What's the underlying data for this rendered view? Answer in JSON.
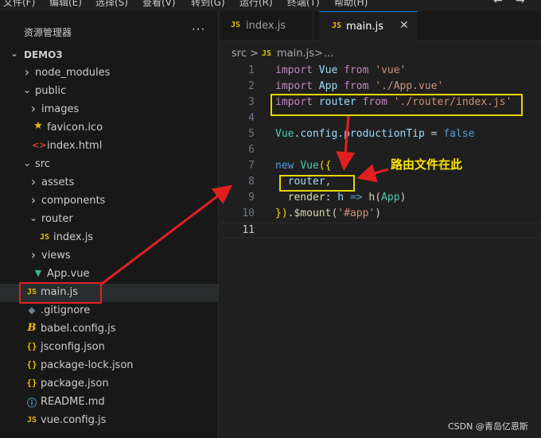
{
  "menubar": {
    "items": [
      "文件(F)",
      "编辑(E)",
      "选择(S)",
      "查看(V)",
      "转到(G)",
      "运行(R)",
      "终端(T)",
      "帮助(H)"
    ],
    "back_icon": "arrow-left-icon",
    "forward_icon": "arrow-right-icon"
  },
  "sidebar": {
    "title": "资源管理器",
    "more": "···",
    "root": "DEMO3",
    "tree": [
      {
        "label": "node_modules",
        "icon": "chevron-right-icon",
        "type": "folder"
      },
      {
        "label": "public",
        "icon": "chevron-down-icon",
        "type": "folder"
      },
      {
        "label": "images",
        "icon": "chevron-right-icon",
        "type": "folder"
      },
      {
        "label": "favicon.ico",
        "icon": "star-icon",
        "type": "file"
      },
      {
        "label": "index.html",
        "icon": "html-icon",
        "type": "file"
      },
      {
        "label": "src",
        "icon": "chevron-down-icon",
        "type": "folder"
      },
      {
        "label": "assets",
        "icon": "chevron-right-icon",
        "type": "folder"
      },
      {
        "label": "components",
        "icon": "chevron-right-icon",
        "type": "folder"
      },
      {
        "label": "router",
        "icon": "chevron-down-icon",
        "type": "folder"
      },
      {
        "label": "index.js",
        "icon": "js-icon",
        "type": "file"
      },
      {
        "label": "views",
        "icon": "chevron-right-icon",
        "type": "folder"
      },
      {
        "label": "App.vue",
        "icon": "vue-icon",
        "type": "file"
      },
      {
        "label": "main.js",
        "icon": "js-icon",
        "type": "file",
        "selected": true
      },
      {
        "label": ".gitignore",
        "icon": "git-icon",
        "type": "file"
      },
      {
        "label": "babel.config.js",
        "icon": "babel-icon",
        "type": "file"
      },
      {
        "label": "jsconfig.json",
        "icon": "json-icon",
        "type": "file"
      },
      {
        "label": "package-lock.json",
        "icon": "json-icon",
        "type": "file"
      },
      {
        "label": "package.json",
        "icon": "json-icon",
        "type": "file"
      },
      {
        "label": "README.md",
        "icon": "info-icon",
        "type": "file"
      },
      {
        "label": "vue.config.js",
        "icon": "js-icon",
        "type": "file"
      }
    ]
  },
  "tabs": [
    {
      "label": "index.js",
      "icon_text": "JS",
      "active": false
    },
    {
      "label": "main.js",
      "icon_text": "JS",
      "active": true,
      "close": "✕"
    }
  ],
  "breadcrumb": {
    "folder": "src",
    "sep": ">",
    "icon_text": "JS",
    "file": "main.js",
    "sep2": ">",
    "more": "..."
  },
  "icon_texts": {
    "js": "JS",
    "json": "{}",
    "html": "<>",
    "git": "◆",
    "babel": "B",
    "info": "ⓘ",
    "star": "★",
    "vue": "▼"
  },
  "code": {
    "lines": [
      {
        "n": "1",
        "tokens": [
          [
            "kw",
            "import"
          ],
          [
            "plain",
            " "
          ],
          [
            "var",
            "Vue"
          ],
          [
            "plain",
            " "
          ],
          [
            "kw",
            "from"
          ],
          [
            "plain",
            " "
          ],
          [
            "str",
            "'vue'"
          ]
        ]
      },
      {
        "n": "2",
        "tokens": [
          [
            "kw",
            "import"
          ],
          [
            "plain",
            " "
          ],
          [
            "var",
            "App"
          ],
          [
            "plain",
            " "
          ],
          [
            "kw",
            "from"
          ],
          [
            "plain",
            " "
          ],
          [
            "str",
            "'./App.vue'"
          ]
        ]
      },
      {
        "n": "3",
        "tokens": [
          [
            "kw",
            "import"
          ],
          [
            "plain",
            " "
          ],
          [
            "var",
            "router"
          ],
          [
            "plain",
            " "
          ],
          [
            "kw",
            "from"
          ],
          [
            "plain",
            " "
          ],
          [
            "str",
            "'./router/index.js'"
          ]
        ]
      },
      {
        "n": "4",
        "tokens": []
      },
      {
        "n": "5",
        "tokens": [
          [
            "cls",
            "Vue"
          ],
          [
            "plain",
            "."
          ],
          [
            "var",
            "config"
          ],
          [
            "plain",
            "."
          ],
          [
            "var",
            "productionTip"
          ],
          [
            "plain",
            " = "
          ],
          [
            "bool",
            "false"
          ]
        ]
      },
      {
        "n": "6",
        "tokens": []
      },
      {
        "n": "7",
        "tokens": [
          [
            "bool",
            "new"
          ],
          [
            "plain",
            " "
          ],
          [
            "cls",
            "Vue"
          ],
          [
            "punc",
            "({"
          ]
        ]
      },
      {
        "n": "8",
        "tokens": [
          [
            "plain",
            "  "
          ],
          [
            "var",
            "router"
          ],
          [
            "plain",
            ","
          ]
        ]
      },
      {
        "n": "9",
        "tokens": [
          [
            "plain",
            "  "
          ],
          [
            "fn",
            "render"
          ],
          [
            "plain",
            ": "
          ],
          [
            "var",
            "h"
          ],
          [
            "plain",
            " "
          ],
          [
            "bool",
            "=>"
          ],
          [
            "plain",
            " "
          ],
          [
            "fn",
            "h"
          ],
          [
            "plain",
            "("
          ],
          [
            "cls",
            "App"
          ],
          [
            "plain",
            ")"
          ]
        ]
      },
      {
        "n": "10",
        "tokens": [
          [
            "punc",
            "})"
          ],
          [
            "plain",
            "."
          ],
          [
            "fn",
            "$mount"
          ],
          [
            "plain",
            "("
          ],
          [
            "str",
            "'#app'"
          ],
          [
            "plain",
            ")"
          ]
        ]
      },
      {
        "n": "11",
        "tokens": [],
        "current": true
      }
    ]
  },
  "annotation": "路由文件在此",
  "watermark": "CSDN @青岛亿恩斯",
  "colors": {
    "arrow": "#e02020",
    "highlight": "#e8d500",
    "annotation": "#ffe600"
  }
}
